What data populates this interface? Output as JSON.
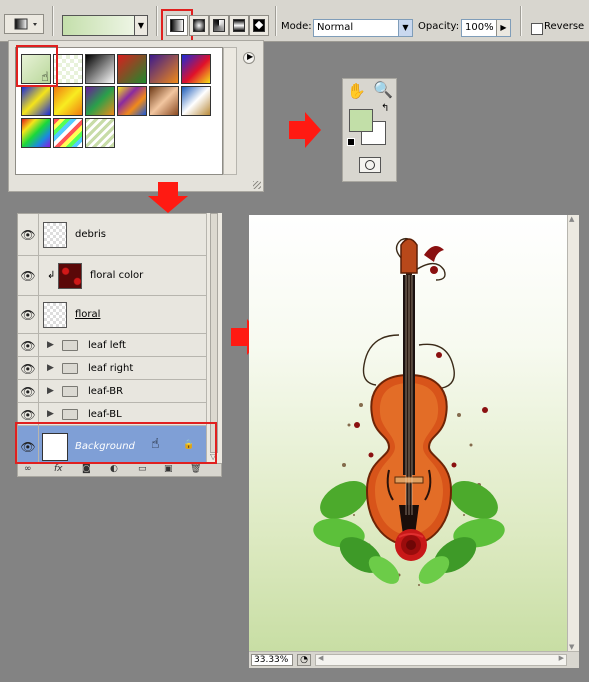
{
  "options_bar": {
    "mode_label": "Mode:",
    "mode_value": "Normal",
    "opacity_label": "Opacity:",
    "opacity_value": "100%",
    "reverse_label": "Reverse",
    "gradient_types": [
      "linear-gradient-icon",
      "radial-gradient-icon",
      "angle-gradient-icon",
      "reflected-gradient-icon",
      "diamond-gradient-icon"
    ]
  },
  "gradient_picker": {
    "presets": [
      {
        "name": "foreground-to-background",
        "css": "linear-gradient(135deg,#e7f2d6,#b9d79a)",
        "selected": true
      },
      {
        "name": "foreground-to-transparent",
        "css": "repeating-conic-gradient(#e8f2da 0 25%,#ffffff 0 50%)"
      },
      {
        "name": "black-white",
        "css": "linear-gradient(135deg,#000,#fff)"
      },
      {
        "name": "red-green",
        "css": "linear-gradient(135deg,#d81f1f,#1d8a2d)"
      },
      {
        "name": "violet-orange",
        "css": "linear-gradient(135deg,#3b1a8c,#f08a1a)"
      },
      {
        "name": "blue-red-yellow",
        "css": "linear-gradient(135deg,#1a2ad8,#e0102a 55%,#f5e41a)"
      },
      {
        "name": "blue-yellow-blue",
        "css": "linear-gradient(135deg,#1a2ad8,#f5e41a 50%,#1a2ad8)"
      },
      {
        "name": "orange-yellow-orange",
        "css": "linear-gradient(135deg,#f07a10,#f8ec20 50%,#f07a10)"
      },
      {
        "name": "violet-green-orange",
        "css": "linear-gradient(135deg,#6a1a9a,#2aa04a 50%,#f08a1a)"
      },
      {
        "name": "yellow-violet-orange-blue",
        "css": "linear-gradient(135deg,#f5e41a,#8a2aa0 35%,#f08a1a 65%,#1a5ad8)"
      },
      {
        "name": "copper",
        "css": "linear-gradient(135deg,#6e3a16,#f2c6a0 50%,#8a4a22)"
      },
      {
        "name": "chrome",
        "css": "linear-gradient(135deg,#1a5ab8,#ffffff 50%,#b88a3a)"
      },
      {
        "name": "spectrum",
        "css": "linear-gradient(135deg,#e01a1a,#f5e41a 25%,#1ad83a 50%,#1a8ae0 75%,#8a1ae0)"
      },
      {
        "name": "transparent-rainbow",
        "css": "repeating-linear-gradient(135deg,#f55 0 4px,#ff5 4px 8px,#5f5 8px 12px,#5cf 12px 16px,#fff 16px 20px)"
      },
      {
        "name": "transparent-stripes",
        "css": "repeating-linear-gradient(135deg,#c8dca8 0 3px,#ffffff 3px 6px)"
      }
    ]
  },
  "toolbox": {
    "foreground_color": "#c2dfa8",
    "background_color": "#ffffff"
  },
  "layers": [
    {
      "name": "debris",
      "type": "layer",
      "thumb": "transparent"
    },
    {
      "name": "floral color",
      "type": "clipped",
      "thumb": "floral"
    },
    {
      "name": "floral",
      "type": "layer",
      "thumb": "transparent"
    },
    {
      "name": "leaf left",
      "type": "group"
    },
    {
      "name": "leaf right",
      "type": "group"
    },
    {
      "name": "leaf-BR",
      "type": "group"
    },
    {
      "name": "leaf-BL",
      "type": "group"
    },
    {
      "name": "Background",
      "type": "background",
      "thumb": "white",
      "selected": true
    }
  ],
  "canvas": {
    "zoom": "33.33%"
  },
  "colors": {
    "highlight_red": "#e0201f",
    "selected_layer": "#7f9fd6",
    "arrow_red": "#ff1a12"
  }
}
